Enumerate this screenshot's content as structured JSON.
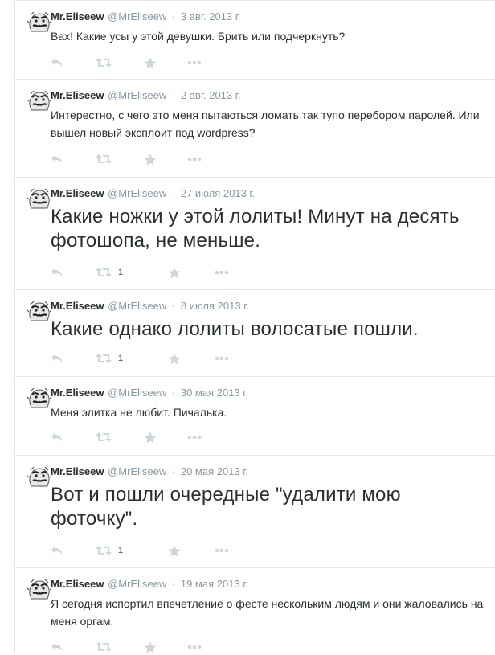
{
  "tweets": [
    {
      "fullname": "Mr.Eliseew",
      "username": "@MrEliseew",
      "separator": "·",
      "time": "3 авг. 2013 г.",
      "text": "Вах! Какие усы у этой девушки. Брить или подчеркнуть?",
      "large": false,
      "retweet_count": "",
      "icons": [
        "reply-icon",
        "retweet-icon",
        "favorite-icon",
        "more-icon"
      ]
    },
    {
      "fullname": "Mr.Eliseew",
      "username": "@MrEliseew",
      "separator": "·",
      "time": "2 авг. 2013 г.",
      "text": "Интерестно, с чего это меня пытаються ломать так тупо перебором паролей. Или вышел новый эксплоит под wordpress?",
      "large": false,
      "retweet_count": "",
      "icons": [
        "reply-icon",
        "retweet-icon",
        "favorite-icon",
        "more-icon"
      ]
    },
    {
      "fullname": "Mr.Eliseew",
      "username": "@MrEliseew",
      "separator": "·",
      "time": "27 июля 2013 г.",
      "text": "Какие ножки у этой лолиты! Минут на десять фотошопа, не меньше.",
      "large": true,
      "retweet_count": "1",
      "icons": [
        "reply-icon",
        "retweet-icon",
        "favorite-icon",
        "more-icon"
      ]
    },
    {
      "fullname": "Mr.Eliseew",
      "username": "@MrEliseew",
      "separator": "·",
      "time": "8 июля 2013 г.",
      "text": "Какие однако лолиты волосатые пошли.",
      "large": true,
      "retweet_count": "1",
      "icons": [
        "reply-icon",
        "retweet-icon",
        "favorite-icon",
        "more-icon"
      ]
    },
    {
      "fullname": "Mr.Eliseew",
      "username": "@MrEliseew",
      "separator": "·",
      "time": "30 мая 2013 г.",
      "text": "Меня элитка не любит. Пичалька.",
      "large": false,
      "retweet_count": "",
      "icons": [
        "reply-icon",
        "retweet-icon",
        "favorite-icon",
        "more-icon"
      ]
    },
    {
      "fullname": "Mr.Eliseew",
      "username": "@MrEliseew",
      "separator": "·",
      "time": "20 мая 2013 г.",
      "text": "Вот и пошли очередные \"удалити мою фоточку\".",
      "large": true,
      "retweet_count": "1",
      "icons": [
        "reply-icon",
        "retweet-icon",
        "favorite-icon",
        "more-icon"
      ]
    },
    {
      "fullname": "Mr.Eliseew",
      "username": "@MrEliseew",
      "separator": "·",
      "time": "19 мая 2013 г.",
      "text": "Я сегодня испортил впечетление о фесте нескольким людям и они жаловались на меня оргам.",
      "large": false,
      "retweet_count": "",
      "icons": [
        "reply-icon",
        "retweet-icon",
        "favorite-icon",
        "more-icon"
      ]
    }
  ],
  "colors": {
    "text": "#292f33",
    "muted": "#8899a6",
    "action_icon": "#ccd6dd",
    "divider": "#e1e8ed"
  }
}
